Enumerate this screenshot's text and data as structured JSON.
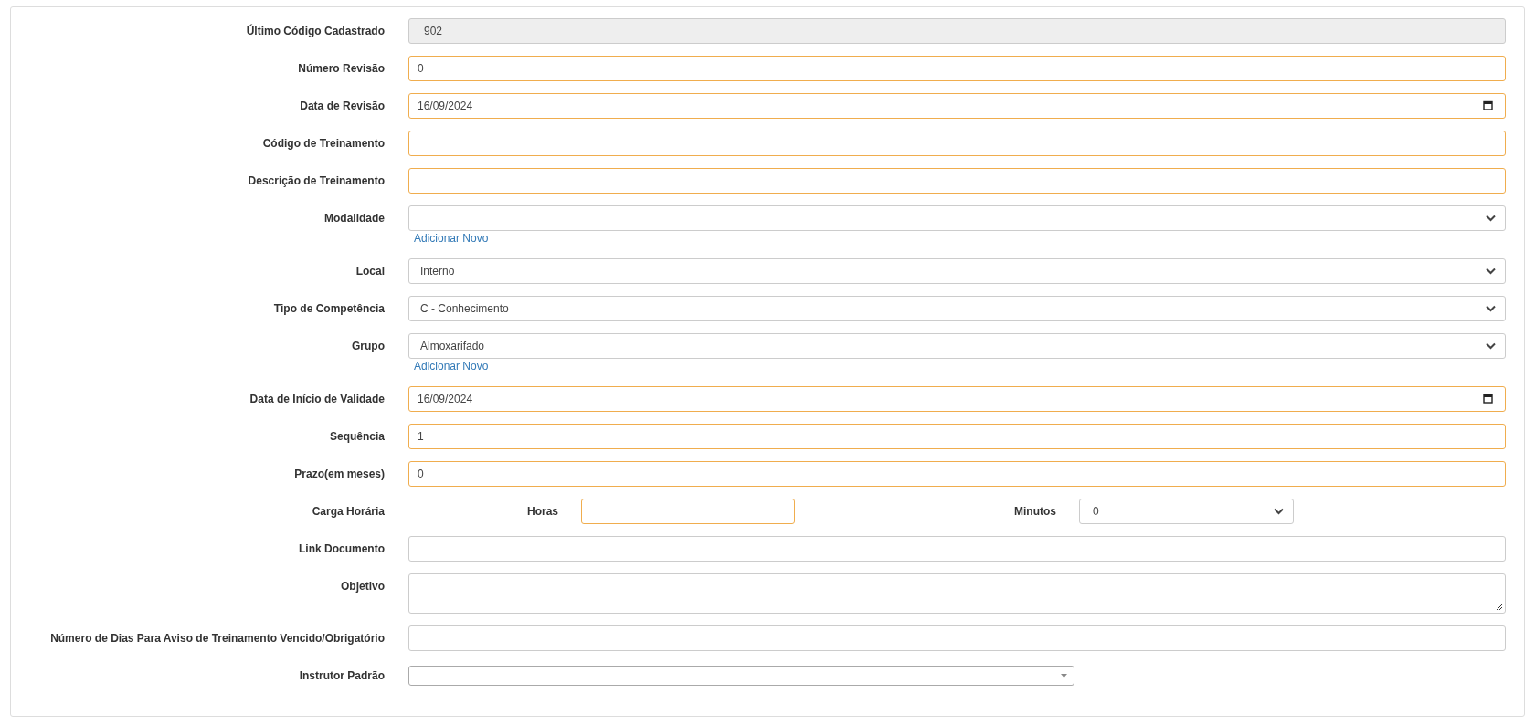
{
  "form": {
    "fields": [
      {
        "kind": "text",
        "label": "Último Código Cadastrado",
        "value": "902",
        "required": false,
        "disabled": true
      },
      {
        "kind": "text",
        "label": "Número Revisão",
        "value": "0",
        "required": true
      },
      {
        "kind": "date",
        "label": "Data de Revisão",
        "value": "16/09/2024",
        "required": true
      },
      {
        "kind": "text",
        "label": "Código de Treinamento",
        "required": true
      },
      {
        "kind": "text",
        "label": "Descrição de Treinamento",
        "required": true
      },
      {
        "kind": "select",
        "label": "Modalidade",
        "required": false,
        "add_link": "Adicionar Novo"
      },
      {
        "kind": "select",
        "label": "Local",
        "value": "Interno",
        "required": false
      },
      {
        "kind": "select",
        "label": "Tipo de Competência",
        "value": "C - Conhecimento",
        "required": false
      },
      {
        "kind": "select",
        "label": "Grupo",
        "value": "Almoxarifado",
        "required": false,
        "add_link": "Adicionar Novo"
      },
      {
        "kind": "date",
        "label": "Data de Início de Validade",
        "value": "16/09/2024",
        "required": true
      },
      {
        "kind": "text",
        "label": "Sequência",
        "value": "1",
        "required": true
      },
      {
        "kind": "text",
        "label": "Prazo(em meses)",
        "value": "0",
        "required": true
      },
      {
        "kind": "workload",
        "label": "Carga Horária",
        "hours_label": "Horas",
        "minutes_label": "Minutos",
        "minutes_value": "0",
        "required": true
      },
      {
        "kind": "text",
        "label": "Link Documento",
        "required": false
      },
      {
        "kind": "textarea",
        "label": "Objetivo",
        "required": false
      },
      {
        "kind": "text",
        "label": "Número de Dias Para Aviso de Treinamento Vencido/Obrigatório",
        "required": false
      },
      {
        "kind": "combo",
        "label": "Instrutor Padrão",
        "required": false
      }
    ]
  }
}
